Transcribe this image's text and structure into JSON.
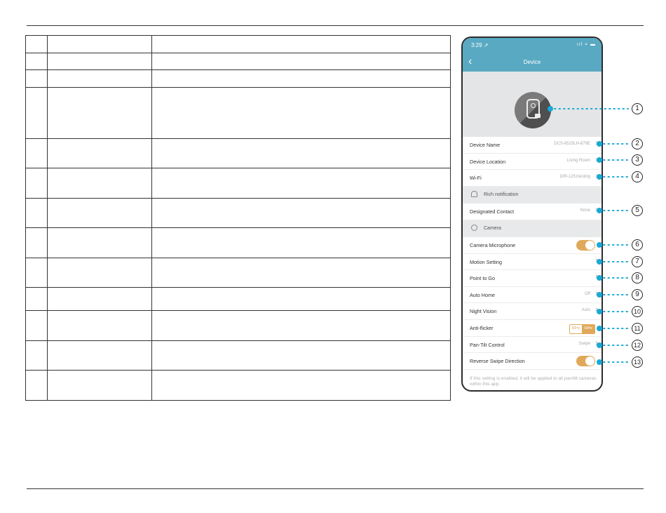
{
  "phone": {
    "status": {
      "time": "3:29 ↗",
      "icons": "ııl ≈ ▬"
    },
    "nav": {
      "back": "‹",
      "title": "Device"
    },
    "rows": {
      "device_name": {
        "label": "Device Name",
        "value": "DCS-8515LH-879E"
      },
      "device_location": {
        "label": "Device Location",
        "value": "Living Room"
      },
      "wifi": {
        "label": "Wi-Fi",
        "value": "DIR-1251testing"
      },
      "designated_contact": {
        "label": "Designated Contact",
        "value": "None"
      },
      "camera_microphone": {
        "label": "Camera Microphone",
        "toggle": "on"
      },
      "motion_setting": {
        "label": "Motion Setting"
      },
      "point_to_go": {
        "label": "Point to Go"
      },
      "auto_home": {
        "label": "Auto Home",
        "value": "Off"
      },
      "night_vision": {
        "label": "Night Vision",
        "value": "Auto"
      },
      "anti_flicker": {
        "label": "Anti-flicker",
        "options": [
          "50Hz",
          "60Hz"
        ],
        "selected": "60Hz"
      },
      "pan_tilt_control": {
        "label": "Pan-Tilt Control",
        "value": "Swipe"
      },
      "reverse_swipe_direction": {
        "label": "Reverse Swipe Direction",
        "toggle": "on"
      }
    },
    "sections": {
      "rich_notification": "Rich notification",
      "camera": "Camera"
    },
    "chevron": "›",
    "footnote": "If this setting is enabled, it will be applied to all pan/tilt cameras within this app."
  },
  "callouts": [
    "1",
    "2",
    "3",
    "4",
    "5",
    "6",
    "7",
    "8",
    "9",
    "10",
    "11",
    "12",
    "13"
  ],
  "colors": {
    "accent": "#59a9c2",
    "toggle": "#e0a85a",
    "callout_dot": "#19a9d6"
  },
  "table": {
    "rows": 13
  }
}
